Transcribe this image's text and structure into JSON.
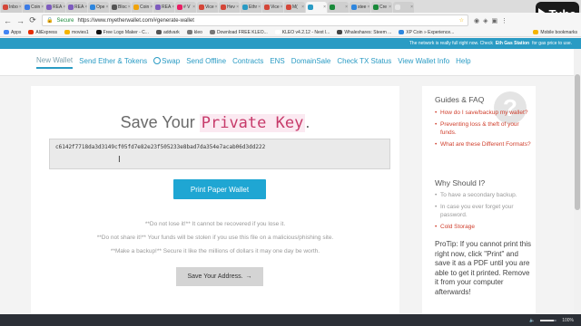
{
  "browser": {
    "tabs": [
      {
        "label": "Inbo",
        "color": "#d44638"
      },
      {
        "label": "Coin",
        "color": "#3b7be6"
      },
      {
        "label": "REA",
        "color": "#7d5bbe"
      },
      {
        "label": "REA",
        "color": "#7d5bbe"
      },
      {
        "label": "Ope",
        "color": "#2e86de"
      },
      {
        "label": "Bloc",
        "color": "#555555"
      },
      {
        "label": "Coin",
        "color": "#f0a30a"
      },
      {
        "label": "REA",
        "color": "#7d5bbe"
      },
      {
        "label": "# V",
        "color": "#e91e63"
      },
      {
        "label": "Vice",
        "color": "#d44638"
      },
      {
        "label": "Hev",
        "color": "#d44638"
      },
      {
        "label": "Ethr",
        "color": "#2a9bc4"
      },
      {
        "label": "Vice",
        "color": "#d44638"
      },
      {
        "label": "M(",
        "color": "#d44638"
      },
      {
        "label": "",
        "color": "#2a9bc4"
      },
      {
        "label": "",
        "color": "#1a8a3a"
      },
      {
        "label": "stee",
        "color": "#2e86de"
      },
      {
        "label": "Cre",
        "color": "#1a8a3a"
      },
      {
        "label": "",
        "color": "#e6e6e6"
      }
    ],
    "active_tab_index": 14,
    "secure_label": "Secure",
    "url": "https://www.myetherwallet.com/#generate-wallet",
    "bookmarks": [
      {
        "label": "Apps",
        "color": "#4285f4"
      },
      {
        "label": "AliExpress",
        "color": "#e62e04"
      },
      {
        "label": "movies1",
        "color": "#f4b400"
      },
      {
        "label": "Free Logo Maker - C...",
        "color": "#111111"
      },
      {
        "label": "addvark",
        "color": "#555555"
      },
      {
        "label": "kleo",
        "color": "#777777"
      },
      {
        "label": "Download FREE KLEO...",
        "color": "#777777"
      },
      {
        "label": "KLEO v4.2.12 - Next l...",
        "color": "#ffffff"
      },
      {
        "label": "Whaleshares: Steem ...",
        "color": "#444444"
      },
      {
        "label": "XP Coin » Experience...",
        "color": "#2e86de"
      }
    ],
    "other_bookmarks": "Mobile bookmarks"
  },
  "brand": {
    "logo_text": "Tube"
  },
  "notice": {
    "text": "The network is really full right now. Check",
    "link": "Eth Gas Station",
    "suffix": "for gas price to use."
  },
  "nav": {
    "items": [
      {
        "label": "New Wallet",
        "active": true
      },
      {
        "label": "Send Ether & Tokens",
        "active": false
      },
      {
        "label": "Swap",
        "active": false,
        "icon": "swap-icon"
      },
      {
        "label": "Send Offline",
        "active": false
      },
      {
        "label": "Contracts",
        "active": false
      },
      {
        "label": "ENS",
        "active": false
      },
      {
        "label": "DomainSale",
        "active": false
      },
      {
        "label": "Check TX Status",
        "active": false
      },
      {
        "label": "View Wallet Info",
        "active": false
      },
      {
        "label": "Help",
        "active": false
      }
    ]
  },
  "main": {
    "title_prefix": "Save Your",
    "title_highlight": "Private Key",
    "title_suffix": ".",
    "private_key": "c6142f7718da3d3149cf05fd7e82e23f505233e8bad7da354e7acab06d3dd222",
    "print_button": "Print Paper Wallet",
    "warnings": [
      "**Do not lose it!** It cannot be recovered if you lose it.",
      "**Do not share it!** Your funds will be stolen if you use this file on a malicious/phishing site.",
      "**Make a backup!** Secure it like the millions of dollars it may one day be worth."
    ],
    "save_button": "Save Your Address.",
    "save_arrow": "→"
  },
  "sidebar": {
    "guides_title": "Guides & FAQ",
    "faq_links": [
      "How do I save/backup my wallet?",
      "Preventing loss & theft of your funds.",
      "What are these Different Formats?"
    ],
    "should_title": "Why Should I?",
    "reasons": [
      {
        "text": "To have a secondary backup.",
        "link": false
      },
      {
        "text": "In case you ever forget your password.",
        "link": false
      },
      {
        "text": "Cold Storage",
        "link": true
      }
    ],
    "protip": "ProTip: If you cannot print this right now, click \"Print\" and save it as a PDF until you are able to get it printed. Remove it from your computer afterwards!"
  },
  "taskbar": {
    "zoom": "100%"
  }
}
